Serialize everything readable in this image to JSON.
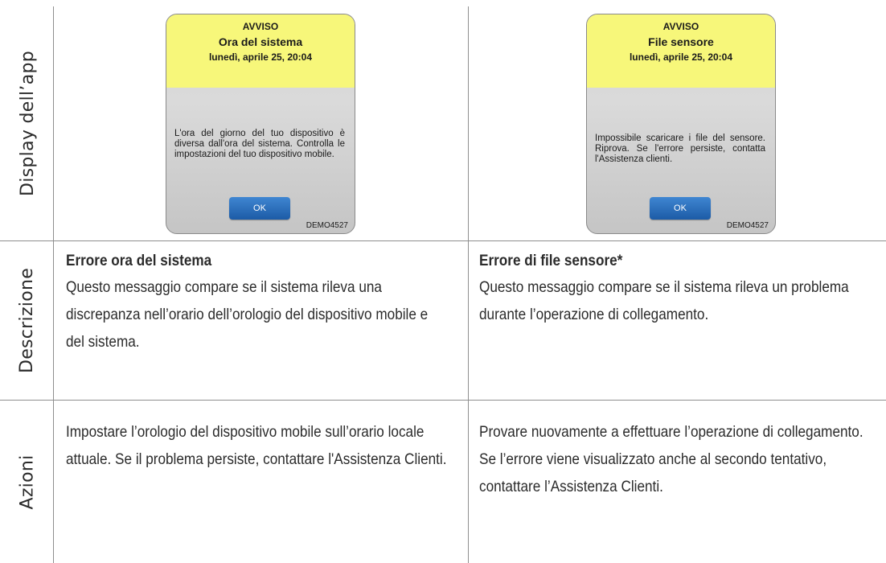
{
  "rows": {
    "display": "Display dell’app",
    "descrizione": "Descrizione",
    "azioni": "Azioni"
  },
  "screens": [
    {
      "header": "AVVISO",
      "title": "Ora del sistema",
      "datetime": "lunedì, aprile 25, 20:04",
      "message": "L'ora del giorno del tuo dispositivo è diversa dall'ora del sistema. Controlla le impostazioni del tuo dispositivo mobile.",
      "button": "OK",
      "code": "DEMO4527"
    },
    {
      "header": "AVVISO",
      "title": "File sensore",
      "datetime": "lunedì, aprile 25, 20:04",
      "message": "Impossibile scaricare i file del sensore. Riprova. Se l'errore persiste, contatta l'Assistenza clienti.",
      "button": "OK",
      "code": "DEMO4527"
    }
  ],
  "descriptions": [
    {
      "title": "Errore ora del sistema",
      "text": "Questo messaggio compare se il sistema rileva una discrepanza nell’orario dell’orologio del dispositivo mobile e del sistema."
    },
    {
      "title": "Errore di file sensore*",
      "text": "Questo messaggio compare se il sistema rileva un problema durante l’operazione di collegamento."
    }
  ],
  "actions": [
    "Impostare l’orologio del dispositivo mobile sull’orario locale attuale. Se il problema persiste, contattare l'Assistenza Clienti.",
    "Provare nuovamente a effettuare l’operazione di collegamento. Se l’errore viene visualizzato anche al secondo tentativo, contattare l’Assistenza Clienti."
  ]
}
